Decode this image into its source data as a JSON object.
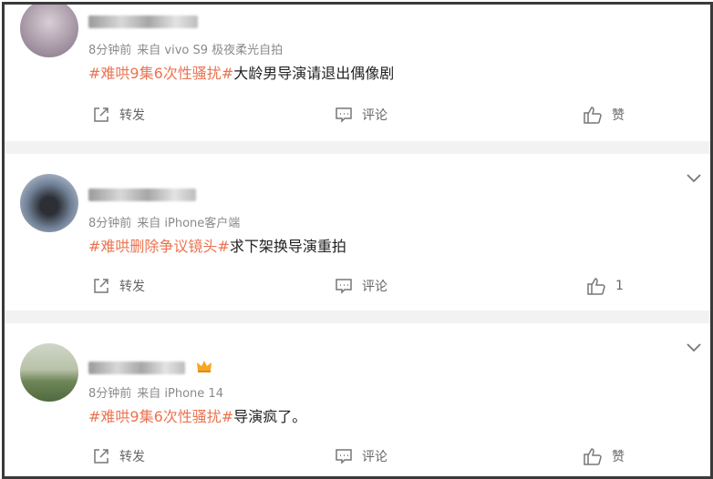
{
  "posts": [
    {
      "time": "8分钟前",
      "source": "来自 vivo S9 极夜柔光自拍",
      "hashtag": "#难哄9集6次性骚扰#",
      "text": "大龄男导演请退出偶像剧",
      "share_label": "转发",
      "comment_label": "评论",
      "like_label": "赞",
      "like_count": "",
      "icons": [
        "avatar-blurred",
        "share-icon",
        "comment-icon",
        "like-icon"
      ]
    },
    {
      "time": "8分钟前",
      "source": "来自 iPhone客户端",
      "hashtag": "#难哄删除争议镜头#",
      "text": "求下架换导演重拍",
      "share_label": "转发",
      "comment_label": "评论",
      "like_label": "",
      "like_count": "1",
      "icons": [
        "avatar-blurred",
        "chevron-down-icon",
        "share-icon",
        "comment-icon",
        "like-icon"
      ]
    },
    {
      "time": "8分钟前",
      "source": "来自 iPhone 14",
      "hashtag": "#难哄9集6次性骚扰#",
      "text": "导演疯了。",
      "share_label": "转发",
      "comment_label": "评论",
      "like_label": "赞",
      "like_count": "",
      "icons": [
        "avatar-blurred",
        "crown-badge-icon",
        "chevron-down-icon",
        "share-icon",
        "comment-icon",
        "like-icon"
      ]
    }
  ],
  "colors": {
    "hashtag": "#eb7350",
    "meta": "#8a8a8a",
    "text": "#222222",
    "separator": "#f2f2f2"
  }
}
